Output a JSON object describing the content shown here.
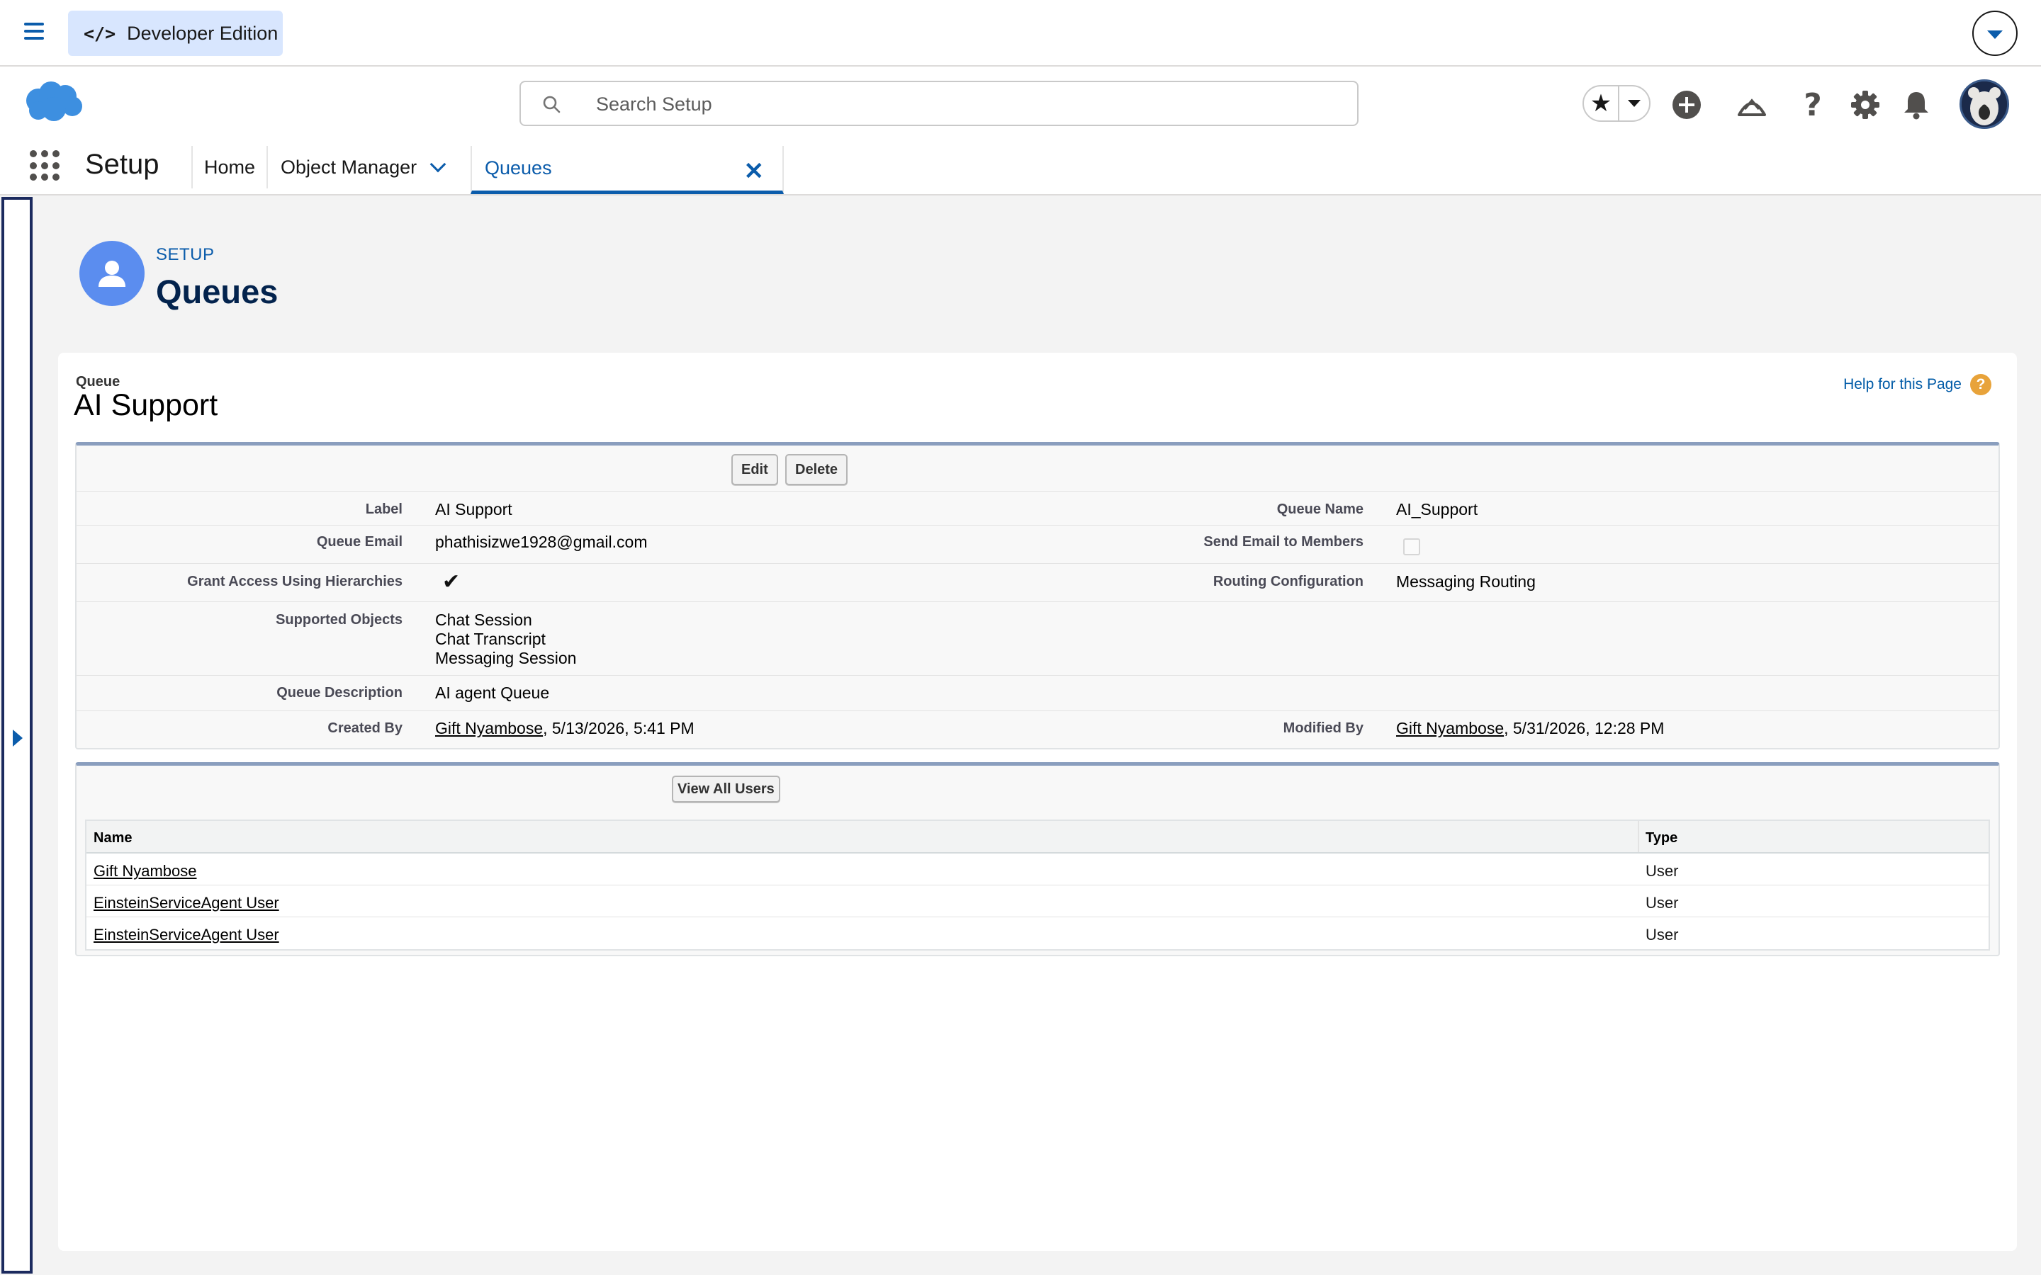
{
  "topbar": {
    "dev_label": "Developer Edition"
  },
  "search": {
    "placeholder": "Search Setup"
  },
  "nav": {
    "app_name": "Setup",
    "home": "Home",
    "object_manager": "Object Manager",
    "active_tab": "Queues"
  },
  "page_header": {
    "eyebrow": "SETUP",
    "title": "Queues"
  },
  "record": {
    "type_label": "Queue",
    "title": "AI Support",
    "help_link": "Help for this Page",
    "buttons": {
      "edit": "Edit",
      "delete": "Delete"
    },
    "fields": {
      "label_label": "Label",
      "label_value": "AI Support",
      "queue_name_label": "Queue Name",
      "queue_name_value": "AI_Support",
      "queue_email_label": "Queue Email",
      "queue_email_value": "phathisizwe1928@gmail.com",
      "send_email_label": "Send Email to Members",
      "send_email_checked": false,
      "grant_access_label": "Grant Access Using Hierarchies",
      "grant_access_checked": true,
      "routing_label": "Routing Configuration",
      "routing_value": "Messaging Routing",
      "supported_objects_label": "Supported Objects",
      "supported_objects": [
        "Chat Session",
        "Chat Transcript",
        "Messaging Session"
      ],
      "description_label": "Queue Description",
      "description_value": "AI agent Queue",
      "created_by_label": "Created By",
      "created_by_user": "Gift Nyambose",
      "created_by_date": ", 5/13/2026, 5:41 PM",
      "modified_by_label": "Modified By",
      "modified_by_user": "Gift Nyambose",
      "modified_by_date": ", 5/31/2026, 12:28 PM"
    }
  },
  "members": {
    "view_all_button": "View All Users",
    "columns": {
      "name": "Name",
      "type": "Type"
    },
    "rows": [
      {
        "name": "Gift Nyambose",
        "type": "User"
      },
      {
        "name": "EinsteinServiceAgent User",
        "type": "User"
      },
      {
        "name": "EinsteinServiceAgent User",
        "type": "User"
      }
    ]
  },
  "colors": {
    "brand_blue": "#0b5cab",
    "header_icon_bg": "#5b8def",
    "title_navy": "#03234d"
  }
}
